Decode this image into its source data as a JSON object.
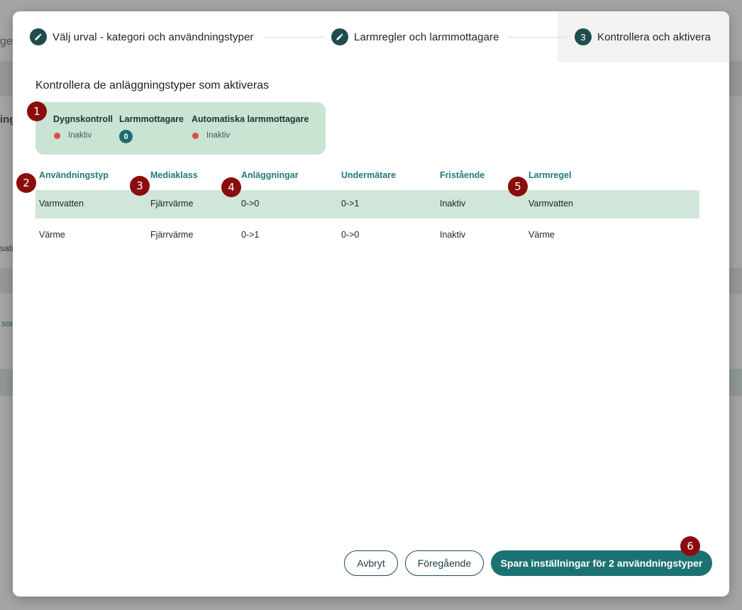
{
  "background": {
    "partial_texts": [
      "ge",
      "ing",
      "sati",
      "son"
    ]
  },
  "stepper": {
    "steps": [
      {
        "label": "Välj urval - kategori och användningstyper",
        "icon": "pencil-icon",
        "number": ""
      },
      {
        "label": "Larmregler och larmmottagare",
        "icon": "pencil-icon",
        "number": ""
      },
      {
        "label": "Kontrollera och aktivera",
        "icon": "",
        "number": "3"
      }
    ]
  },
  "section_title": "Kontrollera de anläggningstyper som aktiveras",
  "summary": {
    "dygnskontroll": {
      "label": "Dygnskontroll",
      "status": "Inaktiv"
    },
    "larmmottagare": {
      "label": "Larmmottagare",
      "count": "0"
    },
    "automatiska": {
      "label": "Automatiska larmmottagare",
      "status": "Inaktiv"
    }
  },
  "table": {
    "columns": [
      "Användningstyp",
      "Mediaklass",
      "Anläggningar",
      "Undermätare",
      "Fristående",
      "Larmregel"
    ],
    "rows": [
      [
        "Varmvatten",
        "Fjärrvärme",
        "0->0",
        "0->1",
        "Inaktiv",
        "Varmvatten"
      ],
      [
        "Värme",
        "Fjärrvärme",
        "0->1",
        "0->0",
        "Inaktiv",
        "Värme"
      ]
    ]
  },
  "markers": [
    "1",
    "2",
    "3",
    "4",
    "5",
    "6"
  ],
  "buttons": {
    "cancel": "Avbryt",
    "previous": "Föregående",
    "save": "Spara inställningar för 2 användningstyper"
  },
  "colors": {
    "primary": "#1c7272",
    "step_circle": "#1d4d4f",
    "summary_bg": "#c9e4d3",
    "selected_row": "#cfe6d8",
    "inactive_dot": "#e24a4a",
    "marker": "#8b0c0c"
  }
}
